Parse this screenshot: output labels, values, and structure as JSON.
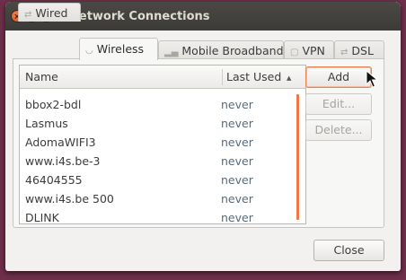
{
  "window": {
    "title": "Network Connections",
    "controls": [
      "close-icon",
      "minimize-icon",
      "maximize-icon"
    ]
  },
  "tabs": [
    {
      "label": "Wired",
      "icon": "wired-icon",
      "active": false
    },
    {
      "label": "Wireless",
      "icon": "wireless-icon",
      "active": true
    },
    {
      "label": "Mobile Broadband",
      "icon": "mobile-broadband-icon",
      "active": false
    },
    {
      "label": "VPN",
      "icon": "vpn-lock-icon",
      "active": false
    },
    {
      "label": "DSL",
      "icon": "dsl-icon",
      "active": false
    }
  ],
  "list": {
    "columns": [
      "Name",
      "Last Used"
    ],
    "sort_icon": "sort-ascending-icon",
    "rows": [
      {
        "name": "bbox2-bdl",
        "used": "never"
      },
      {
        "name": "Lasmus",
        "used": "never"
      },
      {
        "name": "AdomaWIFI3",
        "used": "never"
      },
      {
        "name": "www.i4s.be-3",
        "used": "never"
      },
      {
        "name": "46404555",
        "used": "never"
      },
      {
        "name": "www.i4s.be 500",
        "used": "never"
      },
      {
        "name": "DLINK",
        "used": "never"
      }
    ]
  },
  "buttons": {
    "add": "Add",
    "edit": "Edit...",
    "delete": "Delete...",
    "close": "Close"
  },
  "colors": {
    "accent": "#f07746",
    "titlebar": "#3c3b37",
    "desktop": "#6e2f4a"
  }
}
